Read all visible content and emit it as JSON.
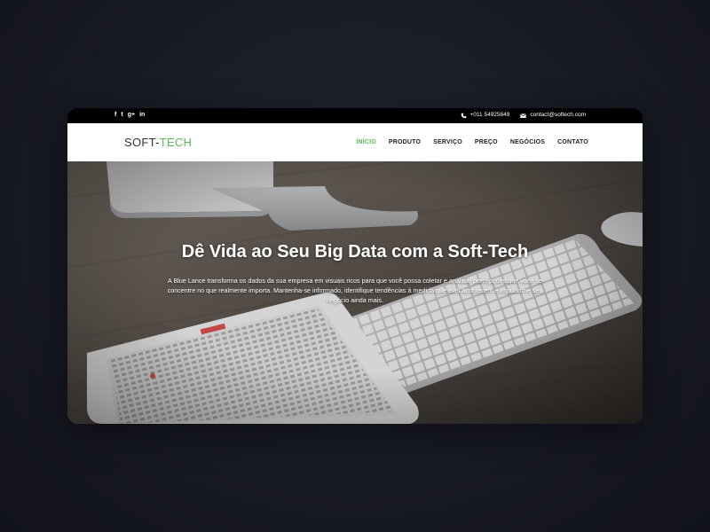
{
  "topbar": {
    "social_icons": [
      {
        "name": "facebook-icon",
        "glyph": "f"
      },
      {
        "name": "twitter-icon",
        "glyph": "t"
      },
      {
        "name": "google-plus-icon",
        "glyph": "g+"
      },
      {
        "name": "linkedin-icon",
        "glyph": "in"
      }
    ],
    "phone": "+011 54925849",
    "email": "contact@softech.com"
  },
  "navbar": {
    "logo_part1": "SOFT-",
    "logo_part2": "TECH",
    "menu": [
      "INÍCIO",
      "PRODUTO",
      "SERVIÇO",
      "PREÇO",
      "NEGÓCIOS",
      "CONTATO"
    ],
    "active_index": 0
  },
  "hero": {
    "title": "Dê Vida ao Seu Big Data com a Soft-Tech",
    "description": "A Blue Lance transforma os dados da sua empresa em visuais ricos para que você possa coletar e analisar percepções que você se concentre no que realmente importa. Mantenha-se informado, identifique tendências à medida que elas acontecem e impulsione seu negócio ainda mais."
  },
  "colors": {
    "accent": "#5cb85c",
    "topbar_bg": "#000000",
    "navbar_bg": "#ffffff",
    "page_bg": "#181a24"
  }
}
